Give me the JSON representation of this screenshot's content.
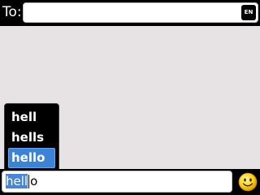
{
  "header": {
    "to_label": "To:",
    "to_value": "",
    "language_badge": "EN"
  },
  "message_area": {
    "background": "#e7e3e4"
  },
  "autocomplete": {
    "suggestions": [
      "hell",
      "hells",
      "hello"
    ],
    "selected_index": 2
  },
  "composer": {
    "text_selected": "hell",
    "text_rest": "o",
    "emoticon_icon": "smiley-face-icon"
  },
  "colors": {
    "highlight": "#3c83d6",
    "bars": "#000000"
  }
}
